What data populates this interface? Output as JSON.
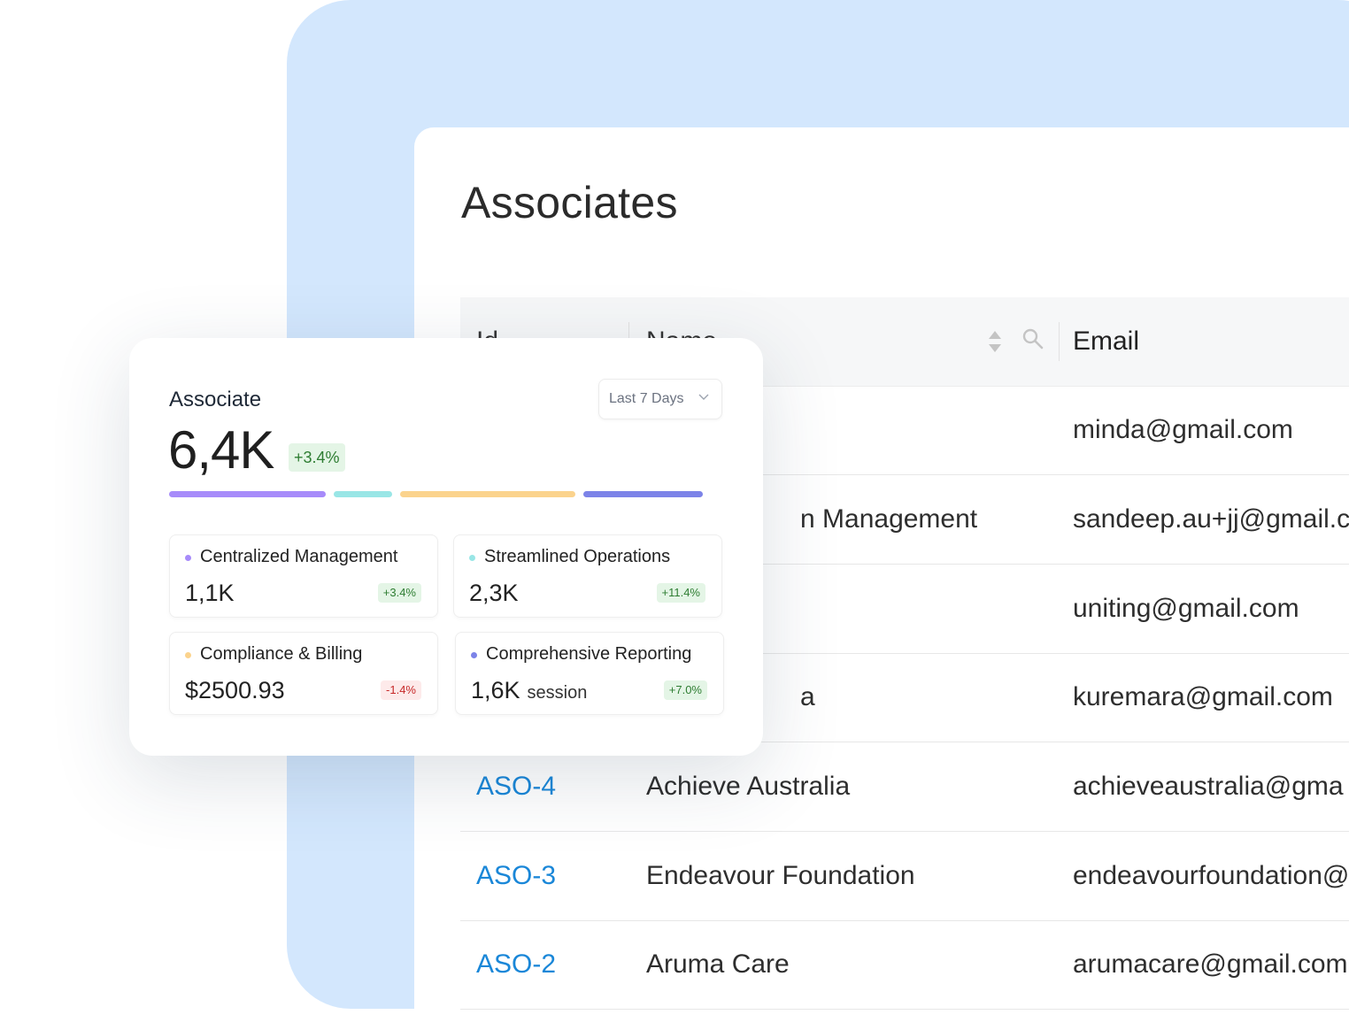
{
  "table": {
    "title": "Associates",
    "columns": {
      "id": "Id",
      "name": "Name",
      "email": "Email"
    },
    "rows": [
      {
        "id": "",
        "name": "",
        "email": "minda@gmail.com"
      },
      {
        "id": "",
        "name": "n Management",
        "email": "sandeep.au+jj@gmail.c"
      },
      {
        "id": "",
        "name": "",
        "email": "uniting@gmail.com"
      },
      {
        "id": "",
        "name": "a",
        "email": "kuremara@gmail.com"
      },
      {
        "id": "ASO-4",
        "name": "Achieve Australia",
        "email": "achieveaustralia@gma"
      },
      {
        "id": "ASO-3",
        "name": "Endeavour Foundation",
        "email": "endeavourfoundation@"
      },
      {
        "id": "ASO-2",
        "name": "Aruma Care",
        "email": "arumacare@gmail.com"
      }
    ]
  },
  "card": {
    "title": "Associate",
    "range": "Last 7 Days",
    "total": "6,4K",
    "total_change": "+3.4%",
    "segments": [
      {
        "color": "#a78bfa",
        "share": 0.295
      },
      {
        "color": "#99e6e6",
        "share": 0.11
      },
      {
        "color": "#fbd38d",
        "share": 0.33
      },
      {
        "color": "#7c83e8",
        "share": 0.225
      }
    ],
    "stats": [
      {
        "label": "Centralized Management",
        "value": "1,1K",
        "unit": "",
        "change": "+3.4%",
        "dot": "#a78bfa",
        "trend": "up"
      },
      {
        "label": "Streamlined Operations",
        "value": "2,3K",
        "unit": "",
        "change": "+11.4%",
        "dot": "#99e6e6",
        "trend": "up"
      },
      {
        "label": "Compliance & Billing",
        "value": "$2500.93",
        "unit": "",
        "change": "-1.4%",
        "dot": "#fbd38d",
        "trend": "down"
      },
      {
        "label": "Comprehensive Reporting",
        "value": "1,6K",
        "unit": "session",
        "change": "+7.0%",
        "dot": "#7c83e8",
        "trend": "up"
      }
    ]
  }
}
